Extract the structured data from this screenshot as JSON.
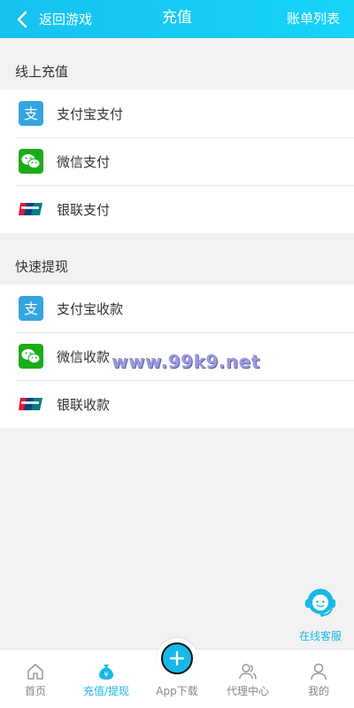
{
  "header": {
    "back_label": "返回游戏",
    "title": "充值",
    "right_label": "账单列表"
  },
  "sections": [
    {
      "title": "线上充值",
      "items": [
        {
          "label": "支付宝支付",
          "icon": "alipay-icon"
        },
        {
          "label": "微信支付",
          "icon": "wechat-icon"
        },
        {
          "label": "银联支付",
          "icon": "unionpay-icon"
        }
      ]
    },
    {
      "title": "快速提现",
      "items": [
        {
          "label": "支付宝收款",
          "icon": "alipay-icon"
        },
        {
          "label": "微信收款",
          "icon": "wechat-icon"
        },
        {
          "label": "银联收款",
          "icon": "unionpay-icon"
        }
      ]
    }
  ],
  "watermark": "www.99k9.net",
  "service": {
    "label": "在线客服"
  },
  "tabbar": [
    {
      "label": "首页",
      "icon": "home-icon"
    },
    {
      "label": "充值/提现",
      "icon": "money-bag-icon",
      "active": true
    },
    {
      "label": "App下载",
      "icon": "plus-icon"
    },
    {
      "label": "代理中心",
      "icon": "users-icon"
    },
    {
      "label": "我的",
      "icon": "user-icon"
    }
  ],
  "colors": {
    "accent": "#17b8e8",
    "alipay": "#35a5e0",
    "wechat": "#1aad19",
    "background": "#f2f2f2"
  }
}
